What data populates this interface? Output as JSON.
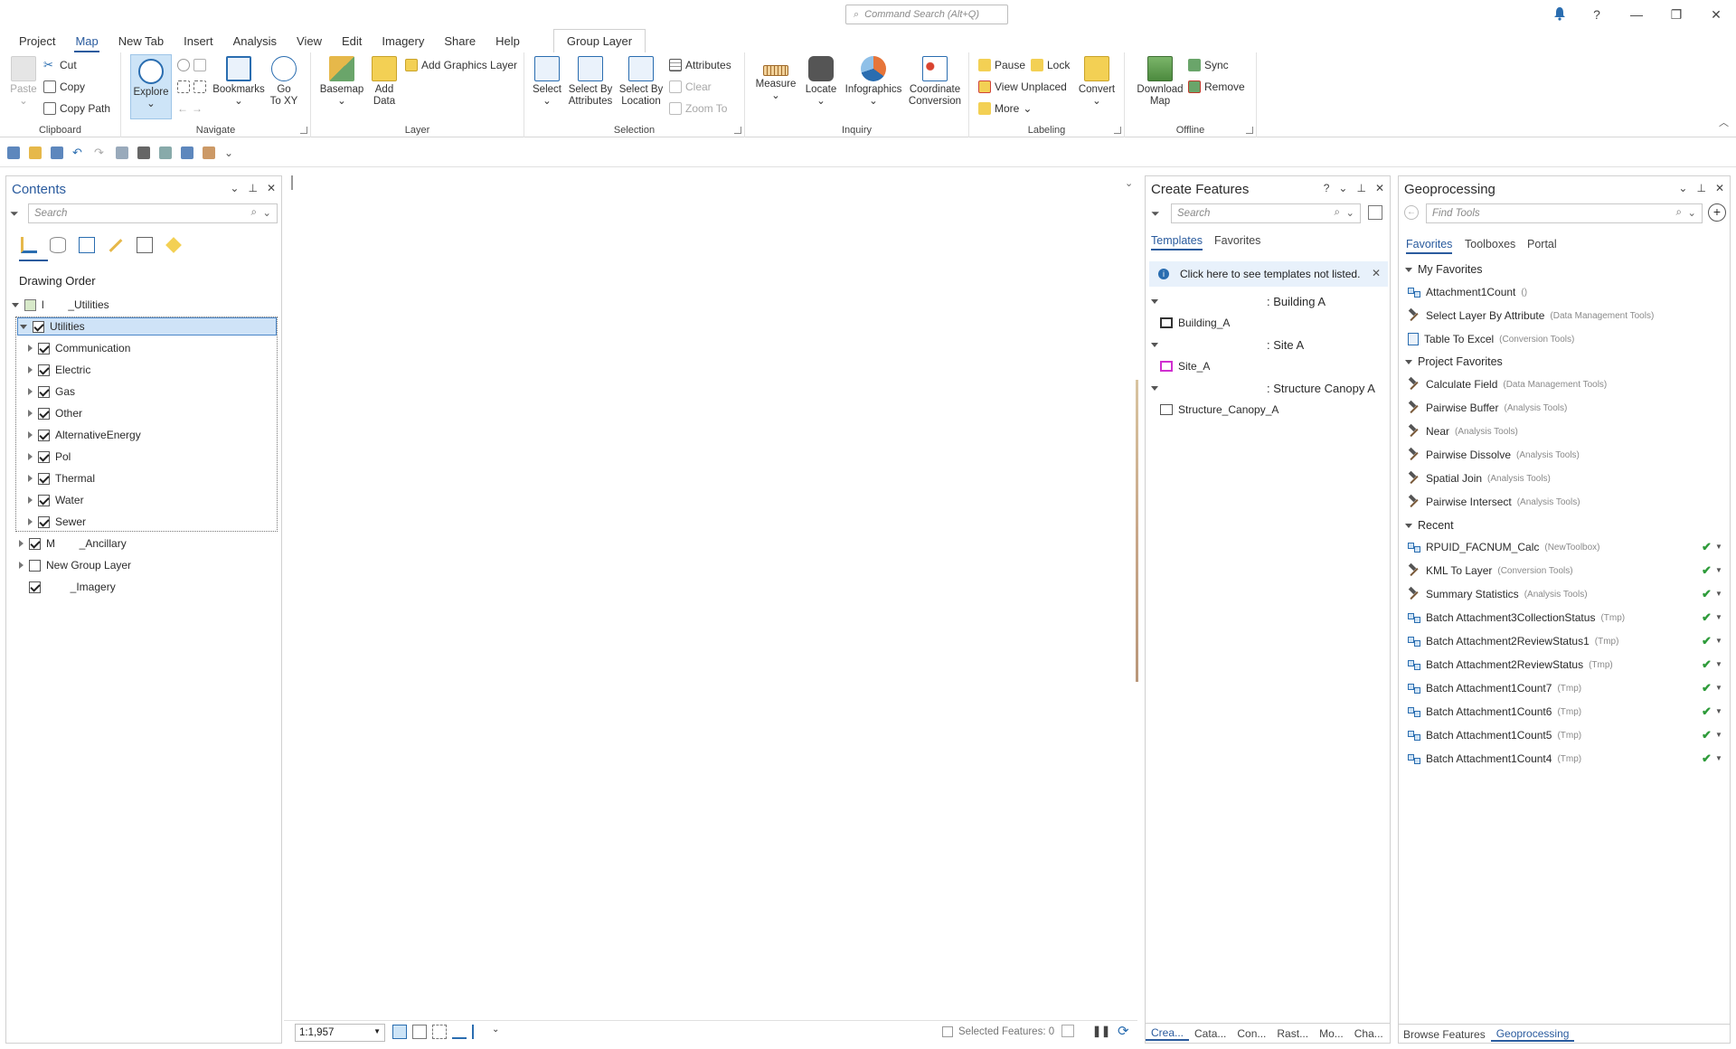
{
  "titlebar": {
    "command_search": "Command Search (Alt+Q)",
    "help": "?",
    "minimize": "—",
    "restore": "❐",
    "close": "✕"
  },
  "ribbon_tabs": [
    {
      "label": "Project"
    },
    {
      "label": "Map",
      "active": true
    },
    {
      "label": "New Tab"
    },
    {
      "label": "Insert"
    },
    {
      "label": "Analysis"
    },
    {
      "label": "View"
    },
    {
      "label": "Edit"
    },
    {
      "label": "Imagery"
    },
    {
      "label": "Share"
    },
    {
      "label": "Help"
    },
    {
      "label": "Group Layer",
      "contextual": true
    }
  ],
  "ribbon": {
    "clipboard": {
      "label": "Clipboard",
      "paste": "Paste",
      "cut": "Cut",
      "copy": "Copy",
      "copy_path": "Copy Path"
    },
    "navigate": {
      "label": "Navigate",
      "explore": "Explore",
      "bookmarks": "Bookmarks",
      "go_to_xy": "Go\nTo XY"
    },
    "layer": {
      "label": "Layer",
      "basemap": "Basemap",
      "add_data": "Add\nData",
      "add_graphics_layer": "Add Graphics Layer"
    },
    "selection": {
      "label": "Selection",
      "select": "Select",
      "select_by_attributes": "Select By\nAttributes",
      "select_by_location": "Select By\nLocation",
      "attributes": "Attributes",
      "clear": "Clear",
      "zoom_to": "Zoom To"
    },
    "inquiry": {
      "label": "Inquiry",
      "measure": "Measure",
      "locate": "Locate",
      "infographics": "Infographics",
      "coordinate_conversion": "Coordinate\nConversion"
    },
    "labeling": {
      "label": "Labeling",
      "pause": "Pause",
      "lock": "Lock",
      "view_unplaced": "View Unplaced",
      "more": "More",
      "convert": "Convert"
    },
    "offline": {
      "label": "Offline",
      "download_map": "Download\nMap",
      "sync": "Sync",
      "remove": "Remove"
    }
  },
  "contents": {
    "title": "Contents",
    "search_placeholder": "Search",
    "drawing_order": "Drawing Order",
    "root": "l        _Utilities",
    "selected_group": "Utilities",
    "layers": [
      "Communication",
      "Electric",
      "Gas",
      "Other",
      "AlternativeEnergy",
      "Pol",
      "Thermal",
      "Water",
      "Sewer"
    ],
    "siblings": [
      {
        "label": "M        _Ancillary",
        "checked": true,
        "expander": true
      },
      {
        "label": "New Group Layer",
        "checked": false,
        "expander": true
      },
      {
        "label": "        _Imagery",
        "checked": true,
        "expander": false
      }
    ]
  },
  "map": {
    "scale": "1:1,957",
    "selected_features": "Selected Features: 0"
  },
  "create_features": {
    "title": "Create Features",
    "help": "?",
    "search_placeholder": "Search",
    "tabs": [
      "Templates",
      "Favorites"
    ],
    "info": "Click here to see templates not listed.",
    "groups": [
      {
        "header": ": Building A",
        "item": "Building_A",
        "swatch": "#333333"
      },
      {
        "header": ": Site A",
        "item": "Site_A",
        "swatch": "#d02fd0"
      },
      {
        "header": ": Structure Canopy A",
        "item": "Structure_Canopy_A",
        "swatch": "#555555"
      }
    ],
    "bottom_tabs": [
      "Crea...",
      "Cata...",
      "Con...",
      "Rast...",
      "Mo...",
      "Cha..."
    ]
  },
  "geoprocessing": {
    "title": "Geoprocessing",
    "search_placeholder": "Find Tools",
    "tabs": [
      "Favorites",
      "Toolboxes",
      "Portal"
    ],
    "my_favorites_header": "My Favorites",
    "my_favorites": [
      {
        "name": "Attachment1Count",
        "cat": "()",
        "icon": "model"
      },
      {
        "name": "Select Layer By Attribute",
        "cat": "(Data Management Tools)",
        "icon": "hammer"
      },
      {
        "name": "Table To Excel",
        "cat": "(Conversion Tools)",
        "icon": "table"
      }
    ],
    "project_favorites_header": "Project Favorites",
    "project_favorites": [
      {
        "name": "Calculate Field",
        "cat": "(Data Management Tools)"
      },
      {
        "name": "Pairwise Buffer",
        "cat": "(Analysis Tools)"
      },
      {
        "name": "Near",
        "cat": "(Analysis Tools)"
      },
      {
        "name": "Pairwise Dissolve",
        "cat": "(Analysis Tools)"
      },
      {
        "name": "Spatial Join",
        "cat": "(Analysis Tools)"
      },
      {
        "name": "Pairwise Intersect",
        "cat": "(Analysis Tools)"
      }
    ],
    "recent_header": "Recent",
    "recent": [
      {
        "name": "RPUID_FACNUM_Calc",
        "cat": "(NewToolbox)",
        "icon": "model"
      },
      {
        "name": "KML To Layer",
        "cat": "(Conversion Tools)",
        "icon": "hammer"
      },
      {
        "name": "Summary Statistics",
        "cat": "(Analysis Tools)",
        "icon": "hammer"
      },
      {
        "name": "Batch Attachment3CollectionStatus",
        "cat": "(Tmp)",
        "icon": "model"
      },
      {
        "name": "Batch Attachment2ReviewStatus1",
        "cat": "(Tmp)",
        "icon": "model"
      },
      {
        "name": "Batch Attachment2ReviewStatus",
        "cat": "(Tmp)",
        "icon": "model"
      },
      {
        "name": "Batch Attachment1Count7",
        "cat": "(Tmp)",
        "icon": "model"
      },
      {
        "name": "Batch Attachment1Count6",
        "cat": "(Tmp)",
        "icon": "model"
      },
      {
        "name": "Batch Attachment1Count5",
        "cat": "(Tmp)",
        "icon": "model"
      },
      {
        "name": "Batch Attachment1Count4",
        "cat": "(Tmp)",
        "icon": "model"
      }
    ],
    "bottom_tabs": [
      "Browse Features",
      "Geoprocessing"
    ]
  },
  "colors": {
    "accent": "#2a5b9e",
    "selection": "#cfe3f7",
    "selection_border": "#4a86c8",
    "success": "#2e9b3a"
  }
}
